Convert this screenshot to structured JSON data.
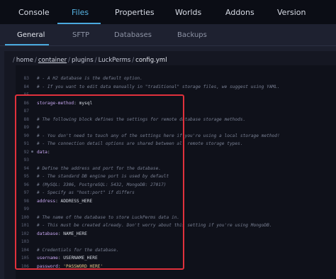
{
  "top_tabs": [
    "Console",
    "Files",
    "Properties",
    "Worlds",
    "Addons",
    "Version"
  ],
  "sub_tabs": [
    "General",
    "SFTP",
    "Databases",
    "Backups"
  ],
  "breadcrumb": [
    "home",
    "container",
    "plugins",
    "LuckPerms",
    "config.yml"
  ],
  "code_lines": [
    {
      "n": "83",
      "t": "#  - A H2 database is the default option."
    },
    {
      "n": "84",
      "t": "#  - If you want to edit data manually in \"traditional\" storage files, we suggest using YAML."
    },
    {
      "n": "85",
      "t": ""
    },
    {
      "n": "86",
      "k": "storage-method",
      "v": "mysql"
    },
    {
      "n": "87",
      "t": ""
    },
    {
      "n": "88",
      "t": "# The following block defines the settings for remote database storage methods."
    },
    {
      "n": "89",
      "t": "#"
    },
    {
      "n": "90",
      "t": "# - You don't need to touch any of the settings here if you're using a local storage method!"
    },
    {
      "n": "91",
      "t": "# - The connection detail options are shared between all remote storage types."
    },
    {
      "n": "92",
      "k": "data",
      "v": ""
    },
    {
      "n": "93",
      "t": ""
    },
    {
      "n": "94",
      "t": "  # Define the address and port for the database."
    },
    {
      "n": "95",
      "t": "  # - The standard DB engine port is used by default"
    },
    {
      "n": "96",
      "t": "  #   (MySQL: 3306, PostgreSQL: 5432, MongoDB: 27017)"
    },
    {
      "n": "97",
      "t": "  # - Specify as \"host:port\" if differs"
    },
    {
      "n": "98",
      "k": "  address",
      "v": "ADDRESS_HERE"
    },
    {
      "n": "99",
      "t": ""
    },
    {
      "n": "100",
      "t": "  # The name of the database to store LuckPerms data in."
    },
    {
      "n": "101",
      "t": "  # - This must be created already. Don't worry about this setting if you're using MongoDB."
    },
    {
      "n": "102",
      "k": "  database",
      "v": "NAME_HERE"
    },
    {
      "n": "103",
      "t": ""
    },
    {
      "n": "104",
      "t": "  # Credentials for the database."
    },
    {
      "n": "105",
      "k": "  username",
      "v": "USERNAME_HERE"
    },
    {
      "n": "106",
      "k": "  password",
      "s": "'PASSWORD_HERE'"
    }
  ]
}
